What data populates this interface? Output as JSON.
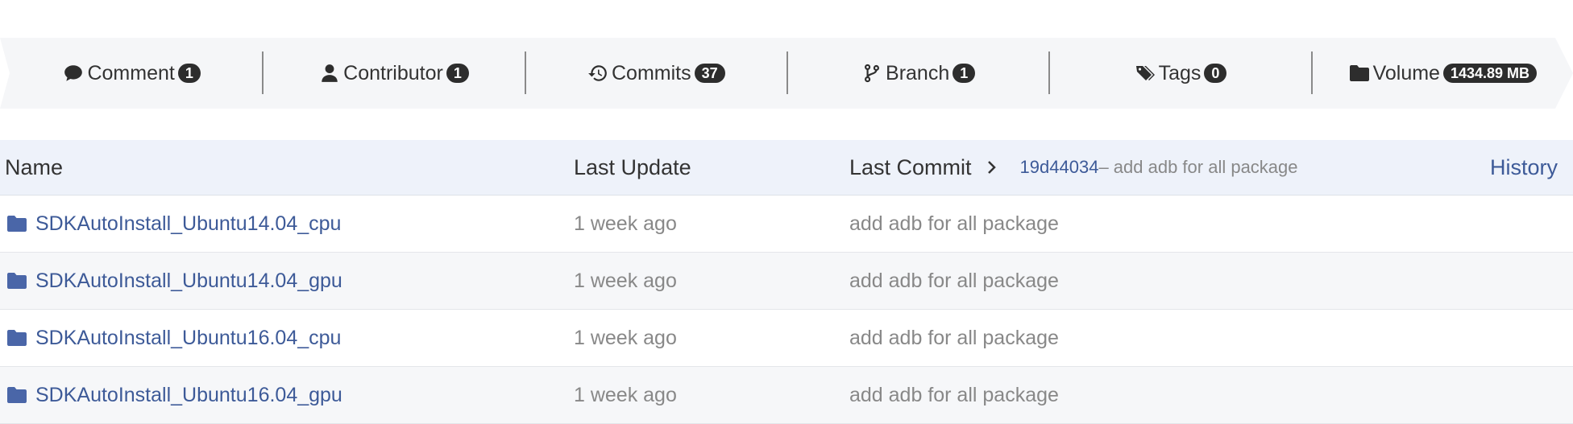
{
  "stats": [
    {
      "icon": "comment-icon",
      "label": "Comment",
      "count": "1"
    },
    {
      "icon": "user-icon",
      "label": "Contributor",
      "count": "1"
    },
    {
      "icon": "history-icon",
      "label": "Commits",
      "count": "37"
    },
    {
      "icon": "branch-icon",
      "label": "Branch",
      "count": "1"
    },
    {
      "icon": "tags-icon",
      "label": "Tags",
      "count": "0"
    },
    {
      "icon": "folder-icon",
      "label": "Volume",
      "count": "1434.89 MB"
    }
  ],
  "table": {
    "headers": {
      "name": "Name",
      "last_update": "Last Update",
      "last_commit": "Last Commit",
      "commit_hash": "19d44034",
      "commit_message": " – add adb for all package",
      "history": "History"
    },
    "rows": [
      {
        "name": "SDKAutoInstall_Ubuntu14.04_cpu",
        "last_update": "1 week ago",
        "last_commit": "add adb for all package"
      },
      {
        "name": "SDKAutoInstall_Ubuntu14.04_gpu",
        "last_update": "1 week ago",
        "last_commit": "add adb for all package"
      },
      {
        "name": "SDKAutoInstall_Ubuntu16.04_cpu",
        "last_update": "1 week ago",
        "last_commit": "add adb for all package"
      },
      {
        "name": "SDKAutoInstall_Ubuntu16.04_gpu",
        "last_update": "1 week ago",
        "last_commit": "add adb for all package"
      }
    ]
  },
  "colors": {
    "link": "#3d5a98",
    "muted_text": "#888888",
    "badge_bg": "#2d2d2d",
    "header_bg": "#eef2fa",
    "stats_bg": "#f5f6f8",
    "folder_icon": "#4a66a8"
  }
}
